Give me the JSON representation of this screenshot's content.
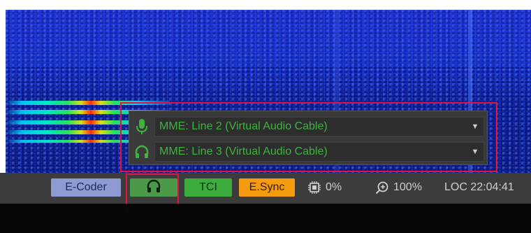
{
  "audio_panel": {
    "input_device": "MME: Line 2 (Virtual Audio Cable)",
    "output_device": "MME: Line 3 (Virtual Audio Cable)"
  },
  "status_bar": {
    "ecoder_label": "E-Coder",
    "tci_label": "TCI",
    "esync_label": "E.Sync",
    "cpu_value": "0%",
    "zoom_value": "100%",
    "clock": "LOC 22:04:41"
  },
  "colors": {
    "highlight": "#e3143a",
    "device_text": "#3fb23f",
    "ecoder": "#8f9ad3",
    "phones": "#4a9a4a",
    "tci": "#3cad3c",
    "esync": "#f49b10"
  },
  "icons": {
    "mic": "microphone-icon",
    "headphones": "headphones-icon",
    "cpu": "cpu-chip-icon",
    "zoom": "zoom-in-icon",
    "dropdown": "chevron-down-icon"
  }
}
